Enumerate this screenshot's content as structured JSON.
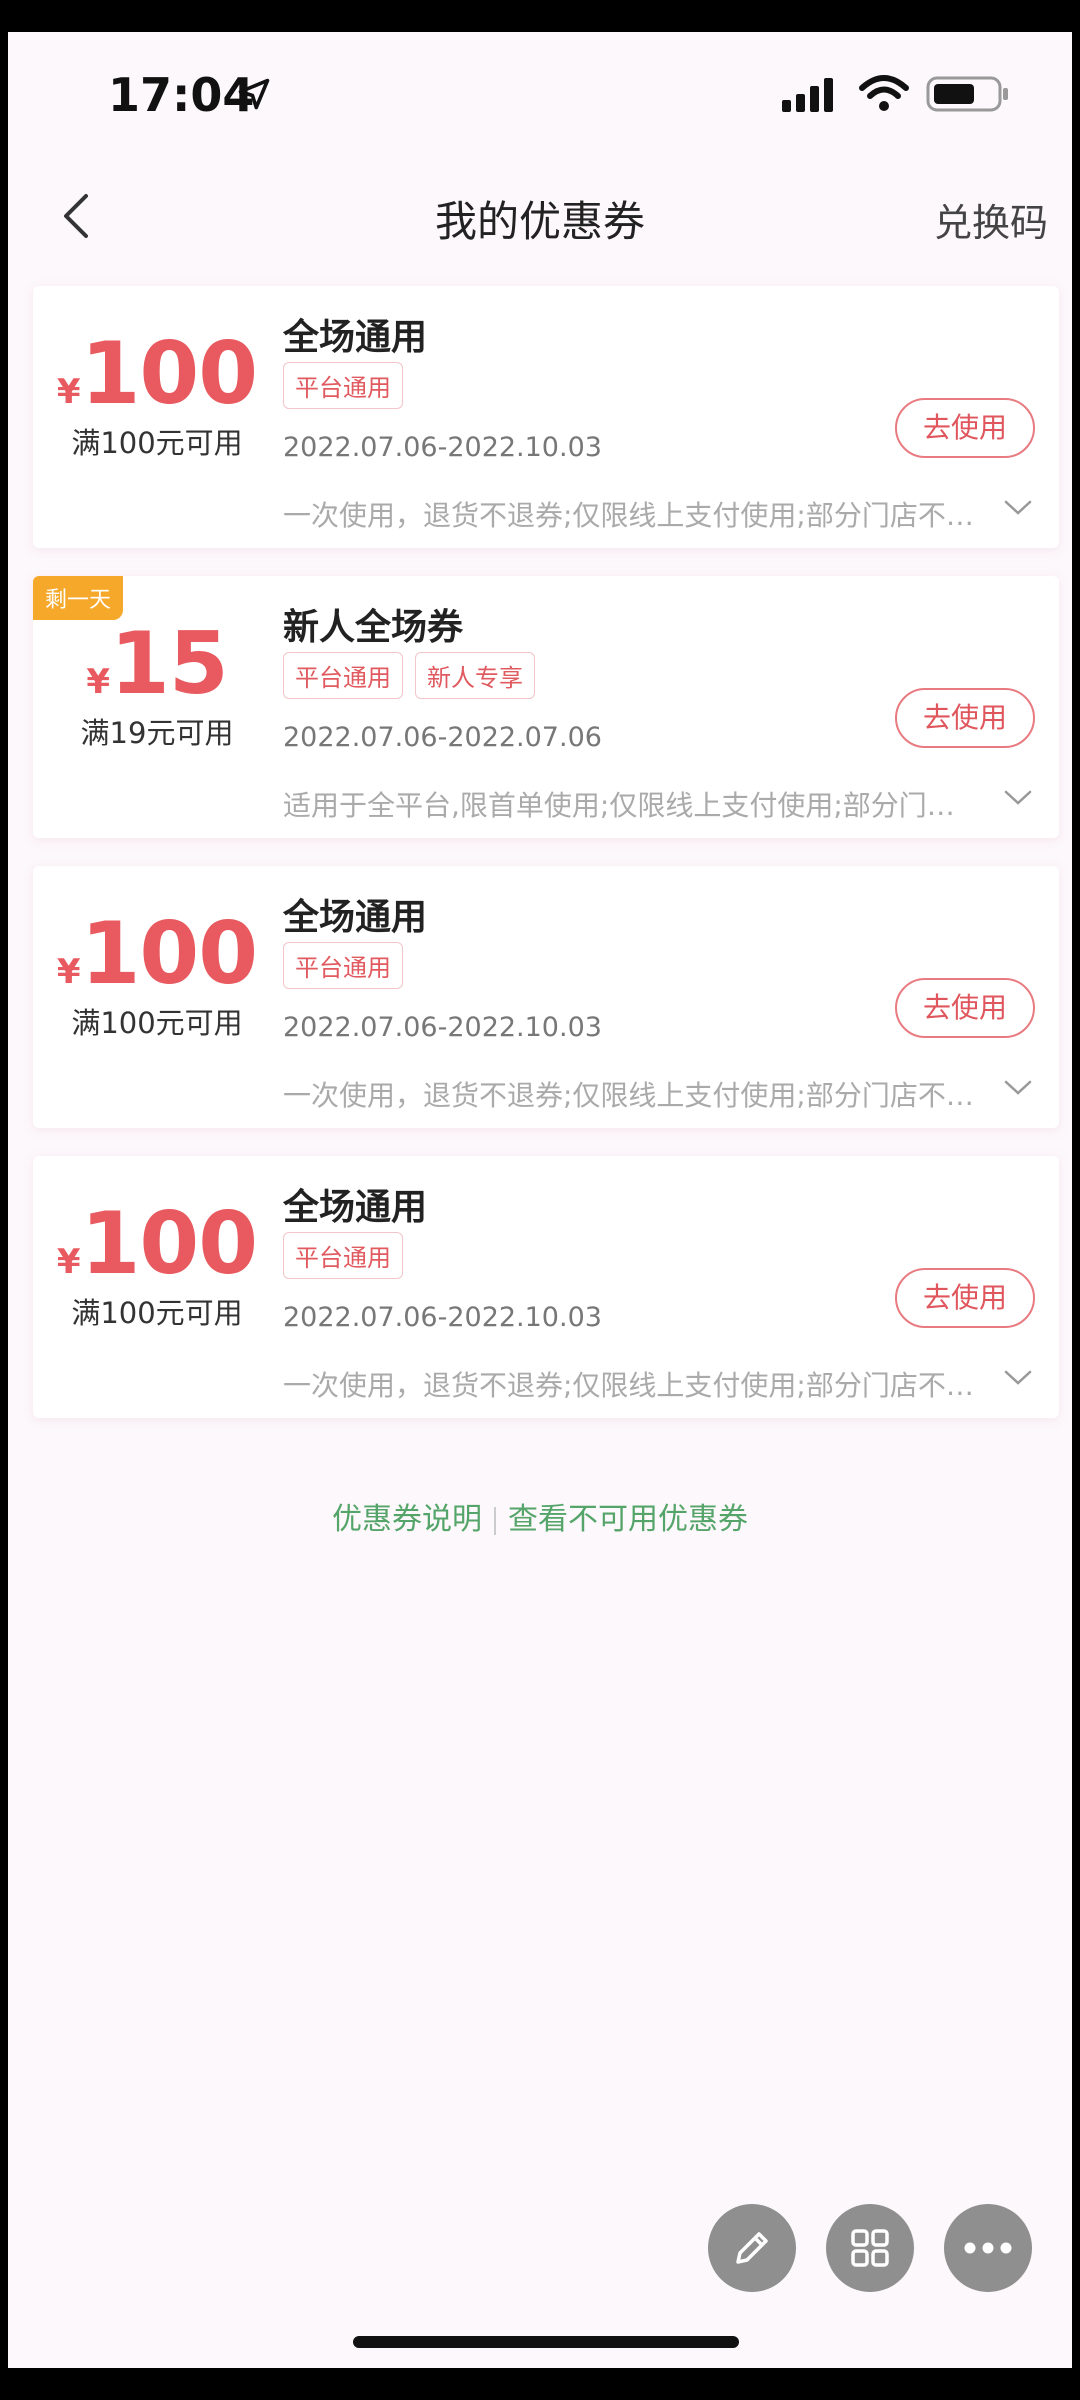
{
  "status_bar": {
    "time": "17:04"
  },
  "nav": {
    "title": "我的优惠券",
    "redeem_label": "兑换码"
  },
  "coupons": [
    {
      "currency": "¥",
      "amount": "100",
      "condition": "满100元可用",
      "title": "全场通用",
      "tags": [
        "平台通用"
      ],
      "dates": "2022.07.06-2022.10.03",
      "description": "一次使用，退货不退券;仅限线上支付使用;部分门店不可用",
      "button": "去使用"
    },
    {
      "badge": "剩一天",
      "currency": "¥",
      "amount": "15",
      "condition": "满19元可用",
      "title": "新人全场券",
      "tags": [
        "平台通用",
        "新人专享"
      ],
      "dates": "2022.07.06-2022.07.06",
      "description": "适用于全平台,限首单使用;仅限线上支付使用;部分门店不可用",
      "button": "去使用"
    },
    {
      "currency": "¥",
      "amount": "100",
      "condition": "满100元可用",
      "title": "全场通用",
      "tags": [
        "平台通用"
      ],
      "dates": "2022.07.06-2022.10.03",
      "description": "一次使用，退货不退券;仅限线上支付使用;部分门店不可用",
      "button": "去使用"
    },
    {
      "currency": "¥",
      "amount": "100",
      "condition": "满100元可用",
      "title": "全场通用",
      "tags": [
        "平台通用"
      ],
      "dates": "2022.07.06-2022.10.03",
      "description": "一次使用，退货不退券;仅限线上支付使用;部分门店不可用",
      "button": "去使用"
    }
  ],
  "links": {
    "explain": "优惠券说明",
    "unavailable": "查看不可用优惠券"
  },
  "colors": {
    "accent": "#e85a5f",
    "link_green": "#55a56a",
    "badge_orange": "#f6a82a"
  },
  "icons": [
    "location-arrow-icon",
    "signal-icon",
    "wifi-icon",
    "battery-icon",
    "back-arrow-icon",
    "chevron-down-icon",
    "pencil-icon",
    "grid-icon",
    "more-icon"
  ]
}
